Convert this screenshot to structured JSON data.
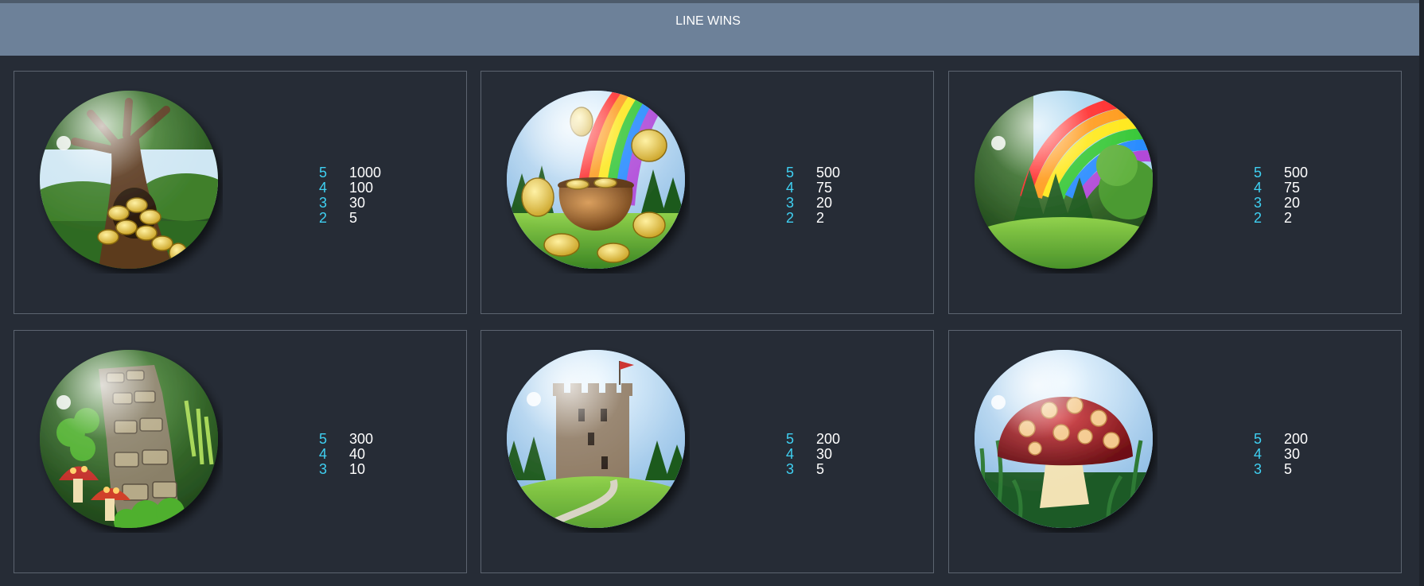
{
  "header": {
    "title": "LINE WINS"
  },
  "symbols": [
    {
      "name": "tree-with-gold-coins",
      "icon": "tree-gold-icon",
      "pays": [
        {
          "count": "5",
          "value": "1000"
        },
        {
          "count": "4",
          "value": "100"
        },
        {
          "count": "3",
          "value": "30"
        },
        {
          "count": "2",
          "value": "5"
        }
      ]
    },
    {
      "name": "pot-of-gold",
      "icon": "pot-of-gold-icon",
      "pays": [
        {
          "count": "5",
          "value": "500"
        },
        {
          "count": "4",
          "value": "75"
        },
        {
          "count": "3",
          "value": "20"
        },
        {
          "count": "2",
          "value": "2"
        }
      ]
    },
    {
      "name": "rainbow",
      "icon": "rainbow-icon",
      "pays": [
        {
          "count": "5",
          "value": "500"
        },
        {
          "count": "4",
          "value": "75"
        },
        {
          "count": "3",
          "value": "20"
        },
        {
          "count": "2",
          "value": "2"
        }
      ]
    },
    {
      "name": "stone-wall-clover",
      "icon": "stone-wall-icon",
      "pays": [
        {
          "count": "5",
          "value": "300"
        },
        {
          "count": "4",
          "value": "40"
        },
        {
          "count": "3",
          "value": "10"
        }
      ]
    },
    {
      "name": "castle-tower",
      "icon": "castle-tower-icon",
      "pays": [
        {
          "count": "5",
          "value": "200"
        },
        {
          "count": "4",
          "value": "30"
        },
        {
          "count": "3",
          "value": "5"
        }
      ]
    },
    {
      "name": "mushroom",
      "icon": "mushroom-icon",
      "pays": [
        {
          "count": "5",
          "value": "200"
        },
        {
          "count": "4",
          "value": "30"
        },
        {
          "count": "3",
          "value": "5"
        }
      ]
    }
  ],
  "colors": {
    "background": "#262c36",
    "header": "#6d8199",
    "count_text": "#3fd0f2",
    "value_text": "#ffffff",
    "card_border": "#5c6470"
  }
}
